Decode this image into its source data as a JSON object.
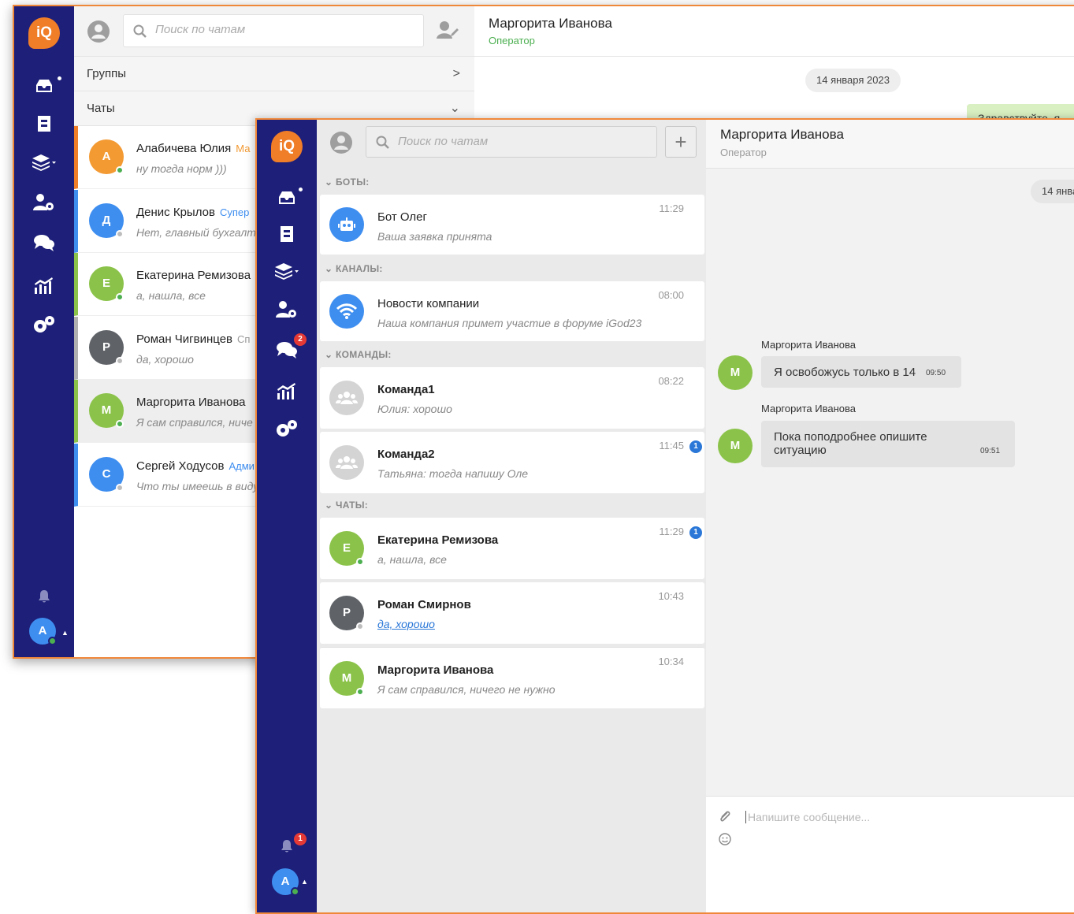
{
  "app": {
    "logo_text": "iQ",
    "me_initial": "A"
  },
  "back": {
    "search_placeholder": "Поиск по чатам",
    "sections": {
      "groups": "Группы",
      "chats": "Чаты"
    },
    "contacts": [
      {
        "initial": "А",
        "name": "Алабичева Юлия",
        "role": "Ма",
        "preview": "ну тогда норм )))",
        "color": "#f39a33",
        "role_color": "#f39a33",
        "bar": "#f07d28",
        "status": "online",
        "bg": "#ffffff"
      },
      {
        "initial": "Д",
        "name": "Денис Крылов",
        "role": "Супер",
        "preview": "Нет, главный бухгалте",
        "color": "#3e8ef0",
        "role_color": "#3e8ef0",
        "bar": "#3e8ef0",
        "status": "offline",
        "bg": "#ffffff"
      },
      {
        "initial": "Е",
        "name": "Екатерина Ремизова",
        "role": "",
        "preview": "а, нашла, все",
        "color": "#8bc34a",
        "role_color": "#8bc34a",
        "bar": "#8bc34a",
        "status": "online",
        "bg": "#ffffff"
      },
      {
        "initial": "Р",
        "name": "Роман Чигвинцев",
        "role": "Сп",
        "preview": "да, хорошо",
        "color": "#5f6368",
        "role_color": "#999999",
        "bar": "#b0b0b0",
        "status": "offline",
        "bg": "#ffffff"
      },
      {
        "initial": "М",
        "name": "Маргорита Иванова",
        "role": "",
        "preview": "Я сам справился, ниче",
        "color": "#8bc34a",
        "role_color": "#8bc34a",
        "bar": "#8bc34a",
        "status": "online",
        "bg": "#eeeeee"
      },
      {
        "initial": "С",
        "name": "Сергей Ходусов",
        "role": "Адми",
        "preview": "Что ты имеешь в виду",
        "color": "#3e8ef0",
        "role_color": "#3e8ef0",
        "bar": "#3e8ef0",
        "status": "offline",
        "bg": "#ffffff"
      }
    ],
    "chat": {
      "name": "Маргорита Иванова",
      "role": "Оператор",
      "role_color": "#4caf50",
      "date": "14 января 2023",
      "partial_message": "Здравствуйте, я"
    }
  },
  "front": {
    "search_placeholder": "Поиск по чатам",
    "add_symbol": "+",
    "chats_badge": "2",
    "bell_badge": "1",
    "categories": {
      "bots": "БОТЫ:",
      "channels": "КАНАЛЫ:",
      "teams": "КОМАНДЫ:",
      "chats": "ЧАТЫ:"
    },
    "bot": {
      "name": "Бот Олег",
      "preview": "Ваша заявка принята",
      "time": "11:29"
    },
    "channel": {
      "name": "Новости компании",
      "preview": "Наша компания примет участие в форуме iGod23",
      "time": "08:00"
    },
    "teams": [
      {
        "name": "Команда1",
        "preview": "Юлия: хорошо",
        "time": "08:22",
        "unread": ""
      },
      {
        "name": "Команда2",
        "preview": "Татьяна: тогда напишу Оле",
        "time": "11:45",
        "unread": "1"
      }
    ],
    "chats": [
      {
        "initial": "Е",
        "name": "Екатерина Ремизова",
        "preview": "а, нашла, все",
        "time": "11:29",
        "unread": "1",
        "color": "#8bc34a",
        "status": "online"
      },
      {
        "initial": "Р",
        "name": "Роман Смирнов",
        "preview": "да, хорошо",
        "time": "10:43",
        "unread": "",
        "color": "#5f6368",
        "status": "offline"
      },
      {
        "initial": "М",
        "name": "Маргорита Иванова",
        "preview": "Я сам справился, ничего не нужно",
        "time": "10:34",
        "unread": "",
        "color": "#8bc34a",
        "status": "online"
      }
    ],
    "conversation": {
      "name": "Маргорита Иванова",
      "role": "Оператор",
      "date": "14 янва",
      "messages": [
        {
          "initial": "М",
          "sender": "Маргорита Иванова",
          "text": "Я освобожусь только в 14",
          "time": "09:50"
        },
        {
          "initial": "М",
          "sender": "Маргорита Иванова",
          "text_line1": "Пока поподробнее опишите",
          "text_line2": "ситуацию",
          "time": "09:51"
        }
      ],
      "composer_placeholder": "Напишите сообщение..."
    }
  }
}
